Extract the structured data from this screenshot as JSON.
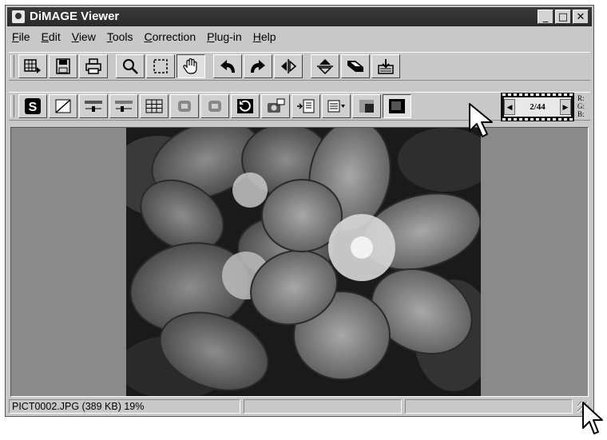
{
  "window": {
    "title": "DiMAGE Viewer"
  },
  "window_controls": {
    "minimize": "_",
    "maximize": "□",
    "close": "✕"
  },
  "menu": [
    {
      "label": "File",
      "accel": "F",
      "rest": "ile"
    },
    {
      "label": "Edit",
      "accel": "E",
      "rest": "dit"
    },
    {
      "label": "View",
      "accel": "V",
      "rest": "iew"
    },
    {
      "label": "Tools",
      "accel": "T",
      "rest": "ools"
    },
    {
      "label": "Correction",
      "accel": "C",
      "rest": "orrection"
    },
    {
      "label": "Plug-in",
      "accel": "P",
      "rest": "lug-in"
    },
    {
      "label": "Help",
      "accel": "H",
      "rest": "elp"
    }
  ],
  "toolbar_main": [
    {
      "icon": "thumbnail-view-icon"
    },
    {
      "icon": "save-icon"
    },
    {
      "icon": "print-icon"
    },
    {
      "icon": "magnifier-icon"
    },
    {
      "icon": "selection-icon"
    },
    {
      "icon": "hand-icon"
    },
    {
      "icon": "rotate-left-icon"
    },
    {
      "icon": "rotate-right-icon"
    },
    {
      "icon": "flip-horizontal-icon"
    },
    {
      "icon": "flip-vertical-icon"
    },
    {
      "icon": "resize-icon"
    },
    {
      "icon": "batch-export-icon"
    }
  ],
  "toolbar_correction": [
    {
      "icon": "s-correction-icon"
    },
    {
      "icon": "tone-curve-icon"
    },
    {
      "icon": "brightness-contrast-icon"
    },
    {
      "icon": "color-balance-icon"
    },
    {
      "icon": "variations-icon"
    },
    {
      "icon": "undo-correction-icon"
    },
    {
      "icon": "redo-correction-icon"
    },
    {
      "icon": "reset-icon"
    },
    {
      "icon": "snapshot-icon"
    },
    {
      "icon": "job-save-icon"
    },
    {
      "icon": "job-list-icon"
    },
    {
      "icon": "before-after-icon"
    },
    {
      "icon": "display-mode-icon"
    }
  ],
  "frame_counter": {
    "text": "2/44",
    "prev": "◀",
    "next": "▶"
  },
  "rgb_readout": {
    "r": "R:",
    "g": "G:",
    "b": "B:"
  },
  "status": {
    "file_info": "PICT0002.JPG (389 KB) 19%",
    "panel2": "",
    "panel3": ""
  }
}
